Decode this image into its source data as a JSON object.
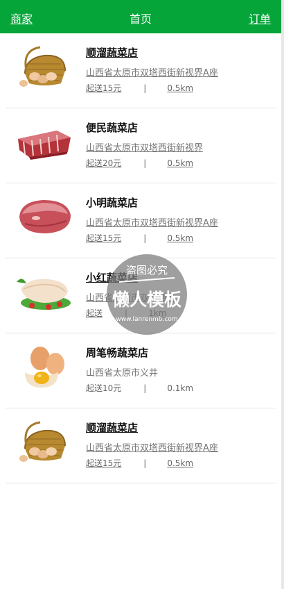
{
  "header": {
    "left_link": "商家",
    "title": "首页",
    "right_link": "订单",
    "bg_color": "#06a53a"
  },
  "shops": [
    {
      "name": "顺溜蔬菜店",
      "address": "山西省太原市双塔西街新视界A座",
      "delivery": "起送15元",
      "distance": "0.5km",
      "image": "basket-eggs-image"
    },
    {
      "name": "便民蔬菜店",
      "address": "山西省太原市双塔西街新视界",
      "delivery": "起送20元",
      "distance": "0.5km",
      "image": "ribs-meat-image"
    },
    {
      "name": "小明蔬菜店",
      "address": "山西省太原市双塔西街新视界A座",
      "delivery": "起送15元",
      "distance": "0.5km",
      "image": "pork-meat-image"
    },
    {
      "name": "小红蔬菜店",
      "address": "山西省太原市双塔西街",
      "delivery": "起送",
      "distance": "1km",
      "image": "chicken-image"
    },
    {
      "name": "周笔畅蔬菜店",
      "address": "山西省太原市义井",
      "delivery": "起送10元",
      "distance": "0.1km",
      "image": "eggs-image"
    },
    {
      "name": "顺溜蔬菜店",
      "address": "山西省太原市双塔西街新视界A座",
      "delivery": "起送15元",
      "distance": "0.5km",
      "image": "basket-eggs-image"
    }
  ],
  "separator": "|",
  "watermark": {
    "top_text": "盗图必究",
    "main_text": "懒人模板",
    "url": "www.lanrenmb.com"
  }
}
